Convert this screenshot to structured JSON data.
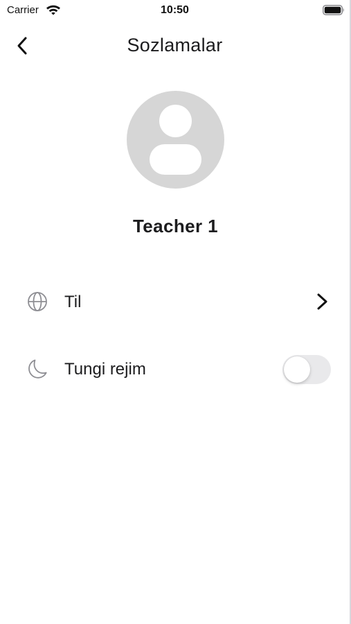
{
  "status_bar": {
    "carrier": "Carrier",
    "time": "10:50",
    "wifi_icon": "wifi-icon",
    "battery_icon": "battery-full-icon"
  },
  "header": {
    "title": "Sozlamalar",
    "back_icon": "chevron-left-icon"
  },
  "profile": {
    "avatar_icon": "user-placeholder-icon",
    "name": "Teacher 1"
  },
  "settings": {
    "language": {
      "label": "Til",
      "icon": "globe-icon",
      "trailing_icon": "chevron-right-icon"
    },
    "night_mode": {
      "label": "Tungi rejim",
      "icon": "moon-icon",
      "enabled": false
    }
  },
  "colors": {
    "avatar_bg": "#d6d6d6",
    "toggle_off_track": "#e9e9eb",
    "text": "#1c1c1e",
    "icon_gray": "#8e8e93"
  }
}
